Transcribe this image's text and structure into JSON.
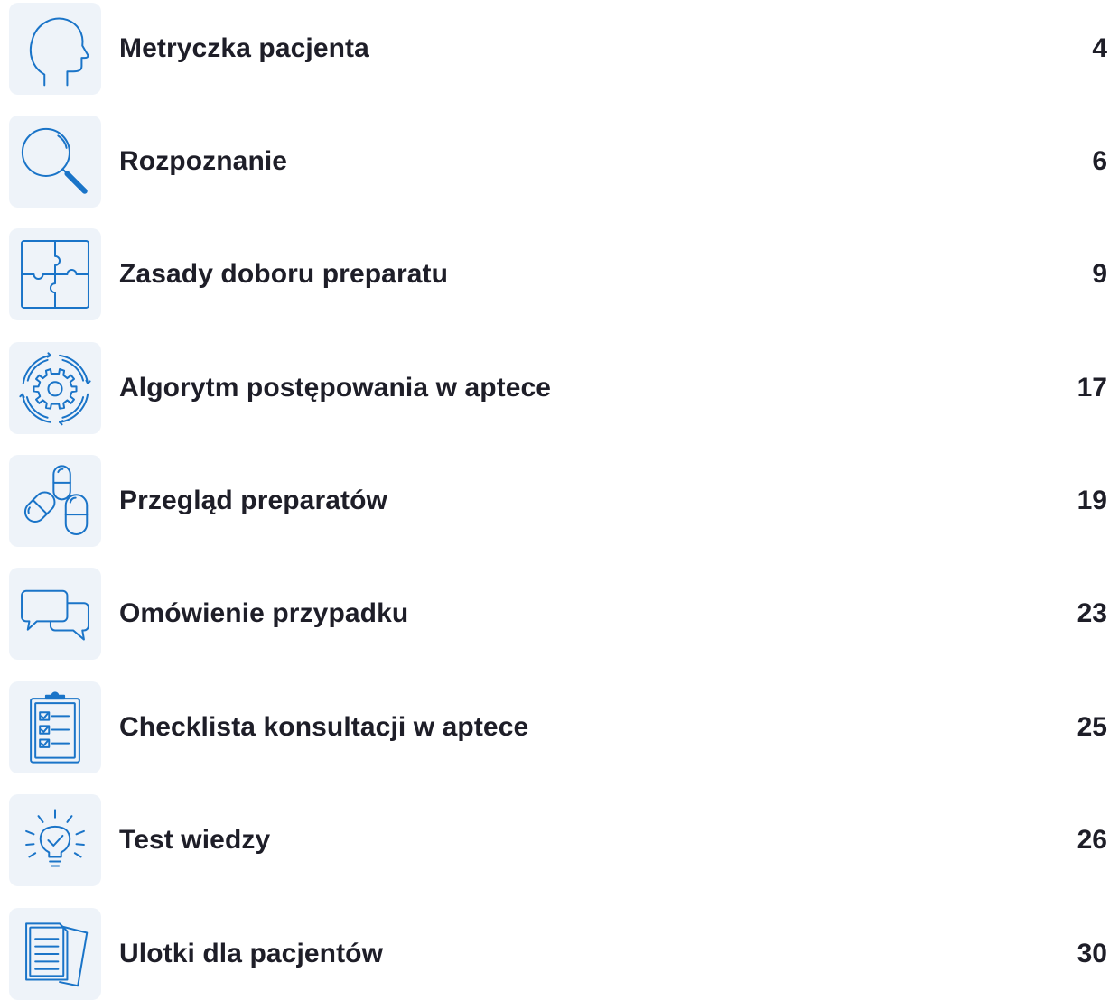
{
  "accent_color": "#1a74c8",
  "icon_background": "#eef3f9",
  "toc": [
    {
      "title": "Metryczka pacjenta",
      "page": "4",
      "icon": "head-profile-icon"
    },
    {
      "title": "Rozpoznanie",
      "page": "6",
      "icon": "magnifier-icon"
    },
    {
      "title": "Zasady doboru preparatu",
      "page": "9",
      "icon": "puzzle-icon"
    },
    {
      "title": "Algorytm postępowania w aptece",
      "page": "17",
      "icon": "gear-cycle-icon"
    },
    {
      "title": "Przegląd preparatów",
      "page": "19",
      "icon": "capsules-icon"
    },
    {
      "title": "Omówienie przypadku",
      "page": "23",
      "icon": "speech-bubbles-icon"
    },
    {
      "title": "Checklista konsultacji w aptece",
      "page": "25",
      "icon": "clipboard-checklist-icon"
    },
    {
      "title": "Test wiedzy",
      "page": "26",
      "icon": "lightbulb-check-icon"
    },
    {
      "title": "Ulotki dla pacjentów",
      "page": "30",
      "icon": "documents-icon"
    }
  ]
}
